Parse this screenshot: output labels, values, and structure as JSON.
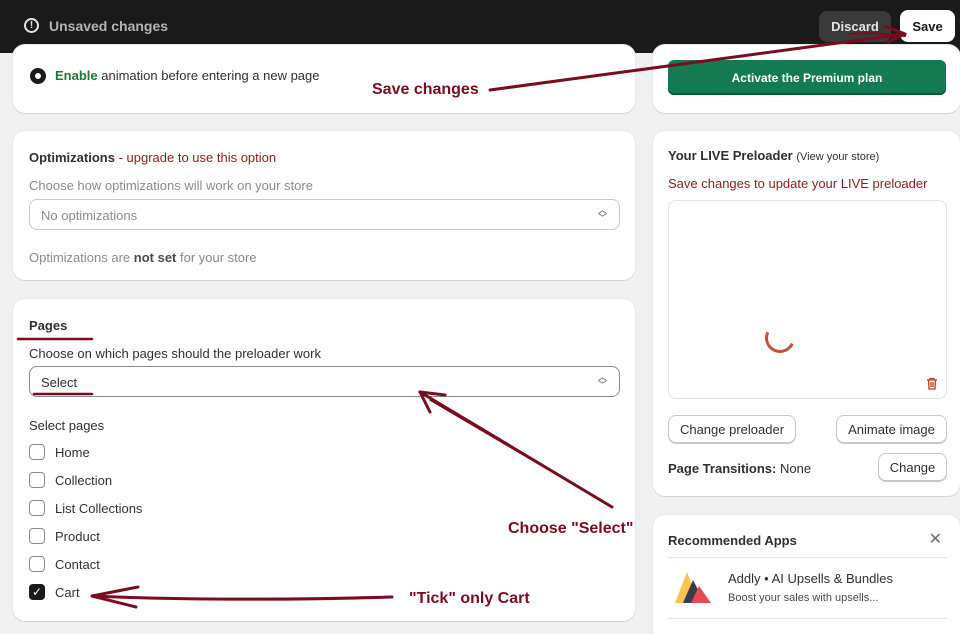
{
  "topbar": {
    "status": "Unsaved changes",
    "discard_label": "Discard",
    "save_label": "Save"
  },
  "animation": {
    "enable_word": "Enable",
    "enable_rest": " animation before entering a new page"
  },
  "premium": {
    "button_label": "Activate the Premium plan"
  },
  "optimizations": {
    "title": "Optimizations",
    "upgrade_text": " - upgrade to use this option",
    "subtitle": "Choose how optimizations will work on your store",
    "select_value": "No optimizations",
    "status_prefix": "Optimizations are ",
    "status_bold": "not set",
    "status_suffix": " for your store"
  },
  "pages": {
    "title": "Pages",
    "subtitle": "Choose on which pages should the preloader work",
    "select_value": "Select",
    "select_pages_label": "Select pages",
    "options": [
      {
        "label": "Home",
        "checked": false
      },
      {
        "label": "Collection",
        "checked": false
      },
      {
        "label": "List Collections",
        "checked": false
      },
      {
        "label": "Product",
        "checked": false
      },
      {
        "label": "Contact",
        "checked": false
      },
      {
        "label": "Cart",
        "checked": true
      }
    ]
  },
  "live": {
    "title": "Your LIVE Preloader",
    "view_link": "(View your store)",
    "warning": "Save changes to update your LIVE preloader",
    "change_preloader_label": "Change preloader",
    "animate_image_label": "Animate image",
    "transitions_label": "Page Transitions:",
    "transitions_value": " None",
    "change_label": "Change"
  },
  "recommended": {
    "title": "Recommended Apps",
    "app_name": "Addly • AI Upsells & Bundles",
    "app_desc": "Boost your sales with upsells..."
  },
  "annotations": {
    "save_changes": "Save changes",
    "choose_select": "Choose \"Select\"",
    "tick_cart": "\"Tick\" only Cart",
    "color": "#7a0c1f"
  },
  "colors": {
    "topbar": "#1a1a1a",
    "premium": "#137a52",
    "warning": "#8b1d1d"
  }
}
